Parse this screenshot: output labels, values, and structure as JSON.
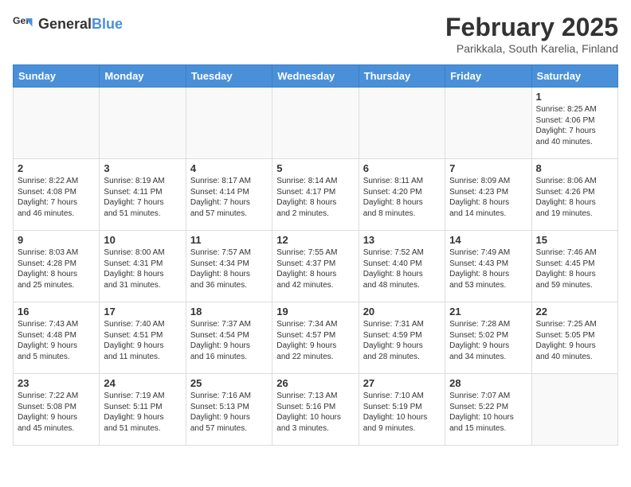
{
  "logo": {
    "general": "General",
    "blue": "Blue"
  },
  "title": "February 2025",
  "subtitle": "Parikkala, South Karelia, Finland",
  "weekdays": [
    "Sunday",
    "Monday",
    "Tuesday",
    "Wednesday",
    "Thursday",
    "Friday",
    "Saturday"
  ],
  "weeks": [
    [
      {
        "day": "",
        "info": ""
      },
      {
        "day": "",
        "info": ""
      },
      {
        "day": "",
        "info": ""
      },
      {
        "day": "",
        "info": ""
      },
      {
        "day": "",
        "info": ""
      },
      {
        "day": "",
        "info": ""
      },
      {
        "day": "1",
        "info": "Sunrise: 8:25 AM\nSunset: 4:06 PM\nDaylight: 7 hours\nand 40 minutes."
      }
    ],
    [
      {
        "day": "2",
        "info": "Sunrise: 8:22 AM\nSunset: 4:08 PM\nDaylight: 7 hours\nand 46 minutes."
      },
      {
        "day": "3",
        "info": "Sunrise: 8:19 AM\nSunset: 4:11 PM\nDaylight: 7 hours\nand 51 minutes."
      },
      {
        "day": "4",
        "info": "Sunrise: 8:17 AM\nSunset: 4:14 PM\nDaylight: 7 hours\nand 57 minutes."
      },
      {
        "day": "5",
        "info": "Sunrise: 8:14 AM\nSunset: 4:17 PM\nDaylight: 8 hours\nand 2 minutes."
      },
      {
        "day": "6",
        "info": "Sunrise: 8:11 AM\nSunset: 4:20 PM\nDaylight: 8 hours\nand 8 minutes."
      },
      {
        "day": "7",
        "info": "Sunrise: 8:09 AM\nSunset: 4:23 PM\nDaylight: 8 hours\nand 14 minutes."
      },
      {
        "day": "8",
        "info": "Sunrise: 8:06 AM\nSunset: 4:26 PM\nDaylight: 8 hours\nand 19 minutes."
      }
    ],
    [
      {
        "day": "9",
        "info": "Sunrise: 8:03 AM\nSunset: 4:28 PM\nDaylight: 8 hours\nand 25 minutes."
      },
      {
        "day": "10",
        "info": "Sunrise: 8:00 AM\nSunset: 4:31 PM\nDaylight: 8 hours\nand 31 minutes."
      },
      {
        "day": "11",
        "info": "Sunrise: 7:57 AM\nSunset: 4:34 PM\nDaylight: 8 hours\nand 36 minutes."
      },
      {
        "day": "12",
        "info": "Sunrise: 7:55 AM\nSunset: 4:37 PM\nDaylight: 8 hours\nand 42 minutes."
      },
      {
        "day": "13",
        "info": "Sunrise: 7:52 AM\nSunset: 4:40 PM\nDaylight: 8 hours\nand 48 minutes."
      },
      {
        "day": "14",
        "info": "Sunrise: 7:49 AM\nSunset: 4:43 PM\nDaylight: 8 hours\nand 53 minutes."
      },
      {
        "day": "15",
        "info": "Sunrise: 7:46 AM\nSunset: 4:45 PM\nDaylight: 8 hours\nand 59 minutes."
      }
    ],
    [
      {
        "day": "16",
        "info": "Sunrise: 7:43 AM\nSunset: 4:48 PM\nDaylight: 9 hours\nand 5 minutes."
      },
      {
        "day": "17",
        "info": "Sunrise: 7:40 AM\nSunset: 4:51 PM\nDaylight: 9 hours\nand 11 minutes."
      },
      {
        "day": "18",
        "info": "Sunrise: 7:37 AM\nSunset: 4:54 PM\nDaylight: 9 hours\nand 16 minutes."
      },
      {
        "day": "19",
        "info": "Sunrise: 7:34 AM\nSunset: 4:57 PM\nDaylight: 9 hours\nand 22 minutes."
      },
      {
        "day": "20",
        "info": "Sunrise: 7:31 AM\nSunset: 4:59 PM\nDaylight: 9 hours\nand 28 minutes."
      },
      {
        "day": "21",
        "info": "Sunrise: 7:28 AM\nSunset: 5:02 PM\nDaylight: 9 hours\nand 34 minutes."
      },
      {
        "day": "22",
        "info": "Sunrise: 7:25 AM\nSunset: 5:05 PM\nDaylight: 9 hours\nand 40 minutes."
      }
    ],
    [
      {
        "day": "23",
        "info": "Sunrise: 7:22 AM\nSunset: 5:08 PM\nDaylight: 9 hours\nand 45 minutes."
      },
      {
        "day": "24",
        "info": "Sunrise: 7:19 AM\nSunset: 5:11 PM\nDaylight: 9 hours\nand 51 minutes."
      },
      {
        "day": "25",
        "info": "Sunrise: 7:16 AM\nSunset: 5:13 PM\nDaylight: 9 hours\nand 57 minutes."
      },
      {
        "day": "26",
        "info": "Sunrise: 7:13 AM\nSunset: 5:16 PM\nDaylight: 10 hours\nand 3 minutes."
      },
      {
        "day": "27",
        "info": "Sunrise: 7:10 AM\nSunset: 5:19 PM\nDaylight: 10 hours\nand 9 minutes."
      },
      {
        "day": "28",
        "info": "Sunrise: 7:07 AM\nSunset: 5:22 PM\nDaylight: 10 hours\nand 15 minutes."
      },
      {
        "day": "",
        "info": ""
      }
    ]
  ]
}
